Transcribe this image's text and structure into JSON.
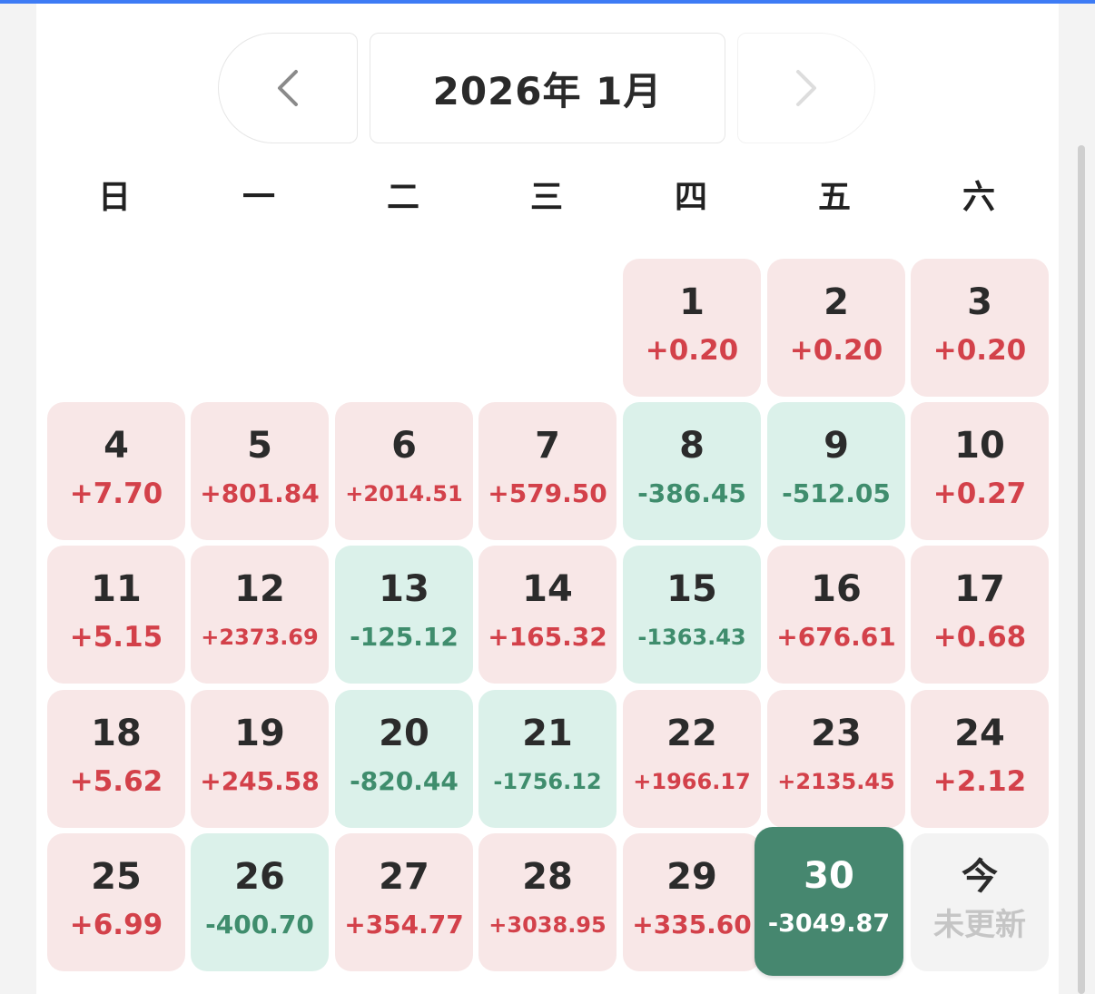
{
  "header": {
    "prev_icon": "chevron-left-icon",
    "next_icon": "chevron-right-icon",
    "month_label": "2026年 1月"
  },
  "weekdays": [
    "日",
    "一",
    "二",
    "三",
    "四",
    "五",
    "六"
  ],
  "colors": {
    "gain_bg": "#f8e7e7",
    "gain_text": "#d3414a",
    "loss_bg": "#dbf1ea",
    "loss_text": "#3f8d6d",
    "selected_bg": "#46876f",
    "today_bg": "#f3f3f3",
    "accent_line": "#3d7bf5"
  },
  "days": [
    {
      "day": "1",
      "value": "+0.20",
      "trend": "up"
    },
    {
      "day": "2",
      "value": "+0.20",
      "trend": "up"
    },
    {
      "day": "3",
      "value": "+0.20",
      "trend": "up"
    },
    {
      "day": "4",
      "value": "+7.70",
      "trend": "up"
    },
    {
      "day": "5",
      "value": "+801.84",
      "trend": "up"
    },
    {
      "day": "6",
      "value": "+2014.51",
      "trend": "up"
    },
    {
      "day": "7",
      "value": "+579.50",
      "trend": "up"
    },
    {
      "day": "8",
      "value": "-386.45",
      "trend": "down"
    },
    {
      "day": "9",
      "value": "-512.05",
      "trend": "down"
    },
    {
      "day": "10",
      "value": "+0.27",
      "trend": "up"
    },
    {
      "day": "11",
      "value": "+5.15",
      "trend": "up"
    },
    {
      "day": "12",
      "value": "+2373.69",
      "trend": "up"
    },
    {
      "day": "13",
      "value": "-125.12",
      "trend": "down"
    },
    {
      "day": "14",
      "value": "+165.32",
      "trend": "up"
    },
    {
      "day": "15",
      "value": "-1363.43",
      "trend": "down"
    },
    {
      "day": "16",
      "value": "+676.61",
      "trend": "up"
    },
    {
      "day": "17",
      "value": "+0.68",
      "trend": "up"
    },
    {
      "day": "18",
      "value": "+5.62",
      "trend": "up"
    },
    {
      "day": "19",
      "value": "+245.58",
      "trend": "up"
    },
    {
      "day": "20",
      "value": "-820.44",
      "trend": "down"
    },
    {
      "day": "21",
      "value": "-1756.12",
      "trend": "down"
    },
    {
      "day": "22",
      "value": "+1966.17",
      "trend": "up"
    },
    {
      "day": "23",
      "value": "+2135.45",
      "trend": "up"
    },
    {
      "day": "24",
      "value": "+2.12",
      "trend": "up"
    },
    {
      "day": "25",
      "value": "+6.99",
      "trend": "up"
    },
    {
      "day": "26",
      "value": "-400.70",
      "trend": "down"
    },
    {
      "day": "27",
      "value": "+354.77",
      "trend": "up"
    },
    {
      "day": "28",
      "value": "+3038.95",
      "trend": "up"
    },
    {
      "day": "29",
      "value": "+335.60",
      "trend": "up"
    },
    {
      "day": "30",
      "value": "-3049.87",
      "trend": "selected"
    },
    {
      "day": "今",
      "value": "未更新",
      "trend": "today"
    }
  ]
}
